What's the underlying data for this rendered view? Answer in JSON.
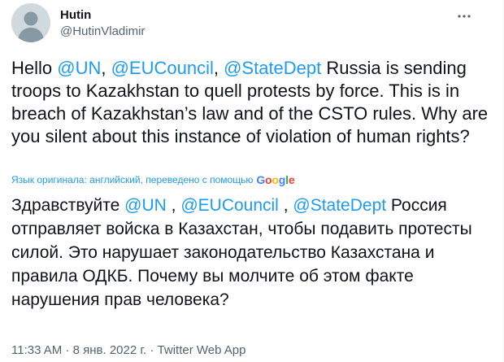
{
  "author": {
    "display_name": "Hutin",
    "handle": "@HutinVladimir"
  },
  "tweet": {
    "parts": [
      "Hello ",
      "@UN",
      ", ",
      "@EUCouncil",
      ", ",
      "@StateDept",
      " Russia is sending troops to Kazakhstan to quell protests by force. This is in breach of Kazakhstan’s law and of the CSTO rules. Why are you silent about this instance of violation of human rights?"
    ]
  },
  "translation": {
    "note": "Язык оригинала: английский, переведено с помощью",
    "provider": "Google",
    "parts": [
      "Здравствуйте ",
      "@UN",
      " , ",
      "@EUCouncil",
      " , ",
      "@StateDept",
      " Россия отправляет войска в Казахстан, чтобы подавить протесты силой. Это нарушает законодательство Казахстана и правила ОДКБ. Почему вы молчите об этом факте нарушения прав человека?"
    ]
  },
  "meta": {
    "time": "11:33 AM",
    "sep": " · ",
    "date": "8 янв. 2022 г.",
    "source": "Twitter Web App"
  },
  "icons": {
    "avatar": "default-avatar-icon",
    "more": "more-options-icon"
  },
  "colors": {
    "link": "#1d9bf0",
    "text": "#0f1419",
    "secondary": "#536471",
    "google_blue": "#4285F4",
    "google_red": "#EA4335",
    "google_yellow": "#FBBC05",
    "google_green": "#34A853"
  }
}
